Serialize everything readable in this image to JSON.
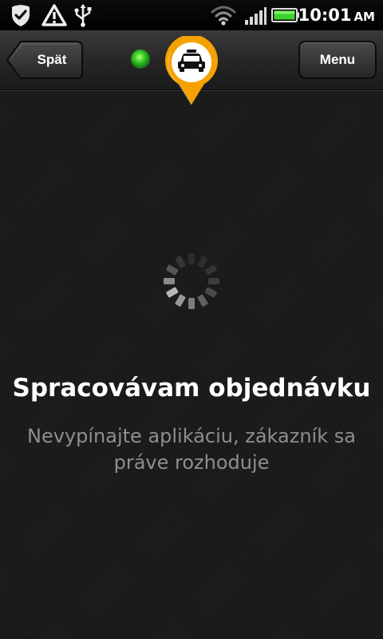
{
  "status_bar": {
    "time": "10:01",
    "ampm": "AM",
    "icons": [
      "check-shield-icon",
      "warning-icon",
      "usb-icon",
      "wifi-icon",
      "signal-icon",
      "battery-icon"
    ]
  },
  "toolbar": {
    "back_label": "Spät",
    "menu_label": "Menu",
    "indicator_color": "#3fd12e",
    "logo_icon": "taxi-pin-icon",
    "accent_color": "#f5a100"
  },
  "main": {
    "spinner_icon": "loading-spinner-icon",
    "title": "Spracovávam objednávku",
    "message": "Nevypínajte aplikáciu, zákazník sa práve rozhoduje"
  }
}
